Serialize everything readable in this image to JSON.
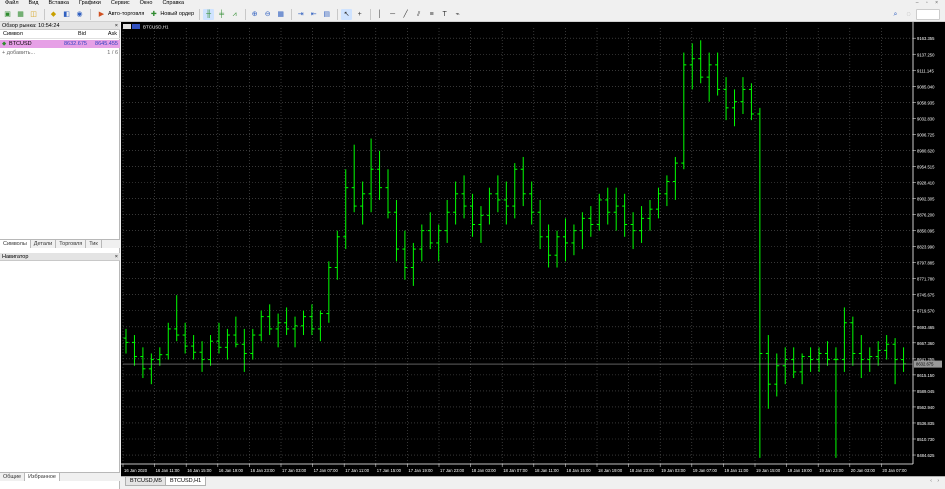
{
  "menu": [
    "Файл",
    "Вид",
    "Вставка",
    "Графики",
    "Сервис",
    "Окно",
    "Справка"
  ],
  "window_controls": "– ▫ ×",
  "toolbar": {
    "auto_trading_label": "Авто-торговля",
    "new_order_label": "Новый ордер",
    "icons": [
      "new-chart-icon",
      "profiles-icon",
      "market-watch-icon",
      "navigator-icon",
      "data-window-icon",
      "signals-icon",
      "bar-chart-icon",
      "candles-icon",
      "line-chart-icon",
      "zoom-in-icon",
      "zoom-out-icon",
      "tile-icon",
      "autoscroll-icon",
      "shift-icon",
      "periods-icon",
      "cursor-icon",
      "crosshair-icon",
      "vertical-line-icon",
      "horizontal-line-icon",
      "trendline-icon",
      "channel-icon",
      "fibonacci-icon",
      "text-icon",
      "shapes-icon",
      "search-icon",
      "chat-icon"
    ]
  },
  "market_watch": {
    "title": "Обзор рынка: 10:54:24",
    "close": "×",
    "headers": {
      "symbol": "Символ",
      "bid": "Bid",
      "ask": "Ask"
    },
    "rows": [
      {
        "symbol": "BTCUSD",
        "bid": "8632.675",
        "ask": "8645.455"
      }
    ],
    "add_label": "+ добавить...",
    "count": "1 / 6",
    "tabs": [
      "Символы",
      "Детали",
      "Торговля",
      "Тик"
    ]
  },
  "navigator": {
    "title": "Навигатор",
    "close": "×",
    "tabs": [
      "Общие",
      "Избранное"
    ]
  },
  "chart": {
    "symbol_label": "BTCUSD,H1",
    "current_price": "8632.675",
    "bar_color": "#00ff00",
    "grid_color": "#5a5a5a",
    "background": "#000000"
  },
  "chart_data": {
    "type": "ohlc",
    "symbol": "BTCUSD",
    "timeframe": "H1",
    "price_labels": [
      "9163.355",
      "9137.250",
      "9111.145",
      "9085.040",
      "9058.935",
      "9032.830",
      "9006.725",
      "8980.620",
      "8954.515",
      "8928.410",
      "8902.305",
      "8876.200",
      "8850.095",
      "8823.990",
      "8797.885",
      "8771.780",
      "8745.675",
      "8719.570",
      "8693.465",
      "8667.360",
      "8641.255",
      "8615.150",
      "8589.045",
      "8562.940",
      "8536.835",
      "8510.730",
      "8484.625"
    ],
    "time_labels": [
      "16 Jan 2020",
      "16 Jan 11:00",
      "16 Jan 15:00",
      "16 Jan 19:00",
      "16 Jan 23:00",
      "17 Jan 03:00",
      "17 Jan 07:00",
      "17 Jan 11:00",
      "17 Jan 15:00",
      "17 Jan 19:00",
      "17 Jan 23:00",
      "18 Jan 03:00",
      "18 Jan 07:00",
      "18 Jan 11:00",
      "18 Jan 15:00",
      "18 Jan 19:00",
      "18 Jan 23:00",
      "19 Jan 03:00",
      "19 Jan 07:00",
      "19 Jan 11:00",
      "19 Jan 15:00",
      "19 Jan 19:00",
      "19 Jan 23:00",
      "20 Jan 03:00",
      "20 Jan 07:00"
    ],
    "ylim": [
      8470,
      9180
    ],
    "bars": [
      [
        8675,
        8690,
        8650,
        8668
      ],
      [
        8668,
        8680,
        8630,
        8645
      ],
      [
        8645,
        8660,
        8610,
        8625
      ],
      [
        8625,
        8650,
        8600,
        8640
      ],
      [
        8640,
        8660,
        8630,
        8648
      ],
      [
        8648,
        8700,
        8640,
        8690
      ],
      [
        8690,
        8745,
        8670,
        8680
      ],
      [
        8680,
        8700,
        8650,
        8662
      ],
      [
        8662,
        8680,
        8640,
        8652
      ],
      [
        8652,
        8670,
        8620,
        8640
      ],
      [
        8640,
        8680,
        8630,
        8670
      ],
      [
        8670,
        8700,
        8650,
        8660
      ],
      [
        8660,
        8690,
        8640,
        8680
      ],
      [
        8680,
        8710,
        8660,
        8665
      ],
      [
        8665,
        8690,
        8620,
        8650
      ],
      [
        8650,
        8690,
        8640,
        8680
      ],
      [
        8680,
        8720,
        8670,
        8710
      ],
      [
        8710,
        8730,
        8680,
        8690
      ],
      [
        8690,
        8715,
        8660,
        8700
      ],
      [
        8700,
        8725,
        8680,
        8690
      ],
      [
        8690,
        8710,
        8660,
        8695
      ],
      [
        8695,
        8720,
        8680,
        8710
      ],
      [
        8710,
        8730,
        8680,
        8690
      ],
      [
        8690,
        8720,
        8670,
        8715
      ],
      [
        8715,
        8800,
        8700,
        8790
      ],
      [
        8790,
        8850,
        8770,
        8840
      ],
      [
        8840,
        8950,
        8820,
        8920
      ],
      [
        8920,
        8990,
        8880,
        8890
      ],
      [
        8890,
        8930,
        8860,
        8910
      ],
      [
        8910,
        9000,
        8880,
        8950
      ],
      [
        8950,
        8980,
        8900,
        8920
      ],
      [
        8920,
        8950,
        8870,
        8880
      ],
      [
        8880,
        8900,
        8800,
        8820
      ],
      [
        8820,
        8850,
        8770,
        8790
      ],
      [
        8790,
        8830,
        8760,
        8820
      ],
      [
        8820,
        8860,
        8800,
        8850
      ],
      [
        8850,
        8880,
        8820,
        8830
      ],
      [
        8830,
        8860,
        8800,
        8850
      ],
      [
        8850,
        8900,
        8830,
        8880
      ],
      [
        8880,
        8930,
        8860,
        8910
      ],
      [
        8910,
        8940,
        8870,
        8890
      ],
      [
        8890,
        8910,
        8840,
        8860
      ],
      [
        8860,
        8890,
        8830,
        8875
      ],
      [
        8875,
        8920,
        8860,
        8910
      ],
      [
        8910,
        8940,
        8880,
        8900
      ],
      [
        8900,
        8930,
        8860,
        8890
      ],
      [
        8890,
        8960,
        8870,
        8950
      ],
      [
        8950,
        8970,
        8890,
        8910
      ],
      [
        8910,
        8930,
        8860,
        8880
      ],
      [
        8880,
        8900,
        8820,
        8840
      ],
      [
        8840,
        8860,
        8790,
        8810
      ],
      [
        8810,
        8850,
        8790,
        8840
      ],
      [
        8840,
        8870,
        8800,
        8830
      ],
      [
        8830,
        8860,
        8810,
        8850
      ],
      [
        8850,
        8880,
        8820,
        8870
      ],
      [
        8870,
        8890,
        8840,
        8860
      ],
      [
        8860,
        8910,
        8850,
        8900
      ],
      [
        8900,
        8920,
        8860,
        8880
      ],
      [
        8880,
        8920,
        8850,
        8890
      ],
      [
        8890,
        8910,
        8840,
        8860
      ],
      [
        8860,
        8880,
        8820,
        8850
      ],
      [
        8850,
        8890,
        8830,
        8870
      ],
      [
        8870,
        8900,
        8850,
        8885
      ],
      [
        8885,
        8920,
        8870,
        8910
      ],
      [
        8910,
        8940,
        8890,
        8930
      ],
      [
        8930,
        8970,
        8900,
        8960
      ],
      [
        8960,
        9140,
        8950,
        9120
      ],
      [
        9120,
        9155,
        9080,
        9130
      ],
      [
        9130,
        9160,
        9090,
        9100
      ],
      [
        9100,
        9140,
        9060,
        9120
      ],
      [
        9120,
        9140,
        9070,
        9080
      ],
      [
        9080,
        9100,
        9030,
        9050
      ],
      [
        9050,
        9080,
        9020,
        9060
      ],
      [
        9060,
        9100,
        9040,
        9080
      ],
      [
        9080,
        9090,
        9030,
        9040
      ],
      [
        9040,
        9050,
        8480,
        8650
      ],
      [
        8650,
        8680,
        8560,
        8600
      ],
      [
        8600,
        8650,
        8580,
        8630
      ],
      [
        8630,
        8660,
        8600,
        8640
      ],
      [
        8640,
        8660,
        8610,
        8620
      ],
      [
        8620,
        8650,
        8600,
        8645
      ],
      [
        8645,
        8660,
        8620,
        8640
      ],
      [
        8640,
        8660,
        8620,
        8650
      ],
      [
        8650,
        8670,
        8630,
        8640
      ],
      [
        8640,
        8660,
        8480,
        8640
      ],
      [
        8640,
        8725,
        8620,
        8700
      ],
      [
        8700,
        8710,
        8630,
        8650
      ],
      [
        8650,
        8680,
        8610,
        8640
      ],
      [
        8640,
        8660,
        8620,
        8645
      ],
      [
        8645,
        8670,
        8630,
        8655
      ],
      [
        8655,
        8680,
        8640,
        8665
      ],
      [
        8665,
        8675,
        8600,
        8640
      ],
      [
        8640,
        8660,
        8620,
        8633
      ]
    ]
  },
  "chart_tabs": [
    "BTCUSD,M5",
    "BTCUSD,H1"
  ],
  "scroll_arrows": "‹ ›"
}
